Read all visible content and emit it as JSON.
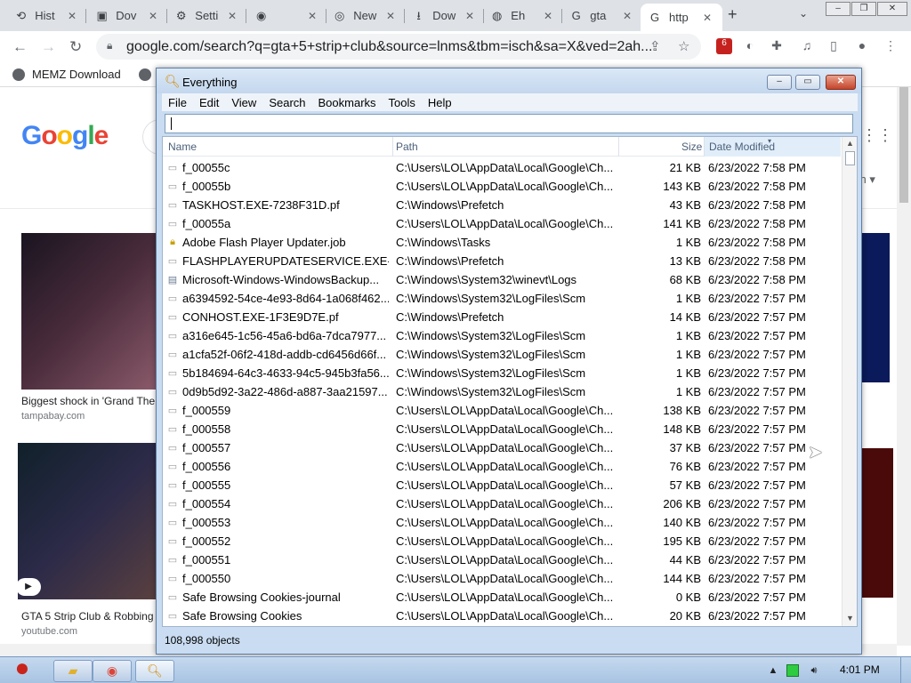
{
  "chrome": {
    "tabs": [
      {
        "label": "Hist",
        "icon": "history-icon",
        "glyph": "⟲"
      },
      {
        "label": "Dov",
        "icon": "gta-icon",
        "glyph": "▣"
      },
      {
        "label": "Setti",
        "icon": "gear-icon",
        "glyph": "⚙"
      },
      {
        "label": "",
        "icon": "app-icon",
        "glyph": "◉"
      },
      {
        "label": "New",
        "icon": "chrome-icon",
        "glyph": "◎"
      },
      {
        "label": "Dow",
        "icon": "download-icon",
        "glyph": "⭳"
      },
      {
        "label": "Eh",
        "icon": "globe-icon",
        "glyph": "◍"
      },
      {
        "label": "gta",
        "icon": "google-icon",
        "glyph": "G"
      },
      {
        "label": "http",
        "icon": "google-icon",
        "glyph": "G"
      }
    ],
    "url": "google.com/search?q=gta+5+strip+club&source=lnms&tbm=isch&sa=X&ved=2ah...",
    "bookmark": "MEMZ Download",
    "ext_badge": "6"
  },
  "google": {
    "logo": "Google",
    "results": [
      {
        "caption": "Biggest shock in 'Grand The",
        "source": "tampabay.com"
      },
      {
        "caption": "GTA 5 Strip Club & Robbing",
        "source": "youtube.com"
      }
    ],
    "more": "ch ▾"
  },
  "everything": {
    "title": "Everything",
    "menu": [
      "File",
      "Edit",
      "View",
      "Search",
      "Bookmarks",
      "Tools",
      "Help"
    ],
    "search_value": "",
    "columns": {
      "name": "Name",
      "path": "Path",
      "size": "Size",
      "date": "Date Modified"
    },
    "rows": [
      {
        "name": "f_00055c",
        "path": "C:\\Users\\LOL\\AppData\\Local\\Google\\Ch...",
        "size": "21 KB",
        "date": "6/23/2022 7:58 PM",
        "icon": "file-icon"
      },
      {
        "name": "f_00055b",
        "path": "C:\\Users\\LOL\\AppData\\Local\\Google\\Ch...",
        "size": "143 KB",
        "date": "6/23/2022 7:58 PM",
        "icon": "file-icon"
      },
      {
        "name": "TASKHOST.EXE-7238F31D.pf",
        "path": "C:\\Windows\\Prefetch",
        "size": "43 KB",
        "date": "6/23/2022 7:58 PM",
        "icon": "file-icon"
      },
      {
        "name": "f_00055a",
        "path": "C:\\Users\\LOL\\AppData\\Local\\Google\\Ch...",
        "size": "141 KB",
        "date": "6/23/2022 7:58 PM",
        "icon": "file-icon"
      },
      {
        "name": "Adobe Flash Player Updater.job",
        "path": "C:\\Windows\\Tasks",
        "size": "1 KB",
        "date": "6/23/2022 7:58 PM",
        "icon": "job-icon"
      },
      {
        "name": "FLASHPLAYERUPDATESERVICE.EXE-EC...",
        "path": "C:\\Windows\\Prefetch",
        "size": "13 KB",
        "date": "6/23/2022 7:58 PM",
        "icon": "file-icon"
      },
      {
        "name": "Microsoft-Windows-WindowsBackup...",
        "path": "C:\\Windows\\System32\\winevt\\Logs",
        "size": "68 KB",
        "date": "6/23/2022 7:58 PM",
        "icon": "log-icon"
      },
      {
        "name": "a6394592-54ce-4e93-8d64-1a068f462...",
        "path": "C:\\Windows\\System32\\LogFiles\\Scm",
        "size": "1 KB",
        "date": "6/23/2022 7:57 PM",
        "icon": "file-icon"
      },
      {
        "name": "CONHOST.EXE-1F3E9D7E.pf",
        "path": "C:\\Windows\\Prefetch",
        "size": "14 KB",
        "date": "6/23/2022 7:57 PM",
        "icon": "file-icon"
      },
      {
        "name": "a316e645-1c56-45a6-bd6a-7dca7977...",
        "path": "C:\\Windows\\System32\\LogFiles\\Scm",
        "size": "1 KB",
        "date": "6/23/2022 7:57 PM",
        "icon": "file-icon"
      },
      {
        "name": "a1cfa52f-06f2-418d-addb-cd6456d66f...",
        "path": "C:\\Windows\\System32\\LogFiles\\Scm",
        "size": "1 KB",
        "date": "6/23/2022 7:57 PM",
        "icon": "file-icon"
      },
      {
        "name": "5b184694-64c3-4633-94c5-945b3fa56...",
        "path": "C:\\Windows\\System32\\LogFiles\\Scm",
        "size": "1 KB",
        "date": "6/23/2022 7:57 PM",
        "icon": "file-icon"
      },
      {
        "name": "0d9b5d92-3a22-486d-a887-3aa21597...",
        "path": "C:\\Windows\\System32\\LogFiles\\Scm",
        "size": "1 KB",
        "date": "6/23/2022 7:57 PM",
        "icon": "file-icon"
      },
      {
        "name": "f_000559",
        "path": "C:\\Users\\LOL\\AppData\\Local\\Google\\Ch...",
        "size": "138 KB",
        "date": "6/23/2022 7:57 PM",
        "icon": "file-icon"
      },
      {
        "name": "f_000558",
        "path": "C:\\Users\\LOL\\AppData\\Local\\Google\\Ch...",
        "size": "148 KB",
        "date": "6/23/2022 7:57 PM",
        "icon": "file-icon"
      },
      {
        "name": "f_000557",
        "path": "C:\\Users\\LOL\\AppData\\Local\\Google\\Ch...",
        "size": "37 KB",
        "date": "6/23/2022 7:57 PM",
        "icon": "file-icon"
      },
      {
        "name": "f_000556",
        "path": "C:\\Users\\LOL\\AppData\\Local\\Google\\Ch...",
        "size": "76 KB",
        "date": "6/23/2022 7:57 PM",
        "icon": "file-icon"
      },
      {
        "name": "f_000555",
        "path": "C:\\Users\\LOL\\AppData\\Local\\Google\\Ch...",
        "size": "57 KB",
        "date": "6/23/2022 7:57 PM",
        "icon": "file-icon"
      },
      {
        "name": "f_000554",
        "path": "C:\\Users\\LOL\\AppData\\Local\\Google\\Ch...",
        "size": "206 KB",
        "date": "6/23/2022 7:57 PM",
        "icon": "file-icon"
      },
      {
        "name": "f_000553",
        "path": "C:\\Users\\LOL\\AppData\\Local\\Google\\Ch...",
        "size": "140 KB",
        "date": "6/23/2022 7:57 PM",
        "icon": "file-icon"
      },
      {
        "name": "f_000552",
        "path": "C:\\Users\\LOL\\AppData\\Local\\Google\\Ch...",
        "size": "195 KB",
        "date": "6/23/2022 7:57 PM",
        "icon": "file-icon"
      },
      {
        "name": "f_000551",
        "path": "C:\\Users\\LOL\\AppData\\Local\\Google\\Ch...",
        "size": "44 KB",
        "date": "6/23/2022 7:57 PM",
        "icon": "file-icon"
      },
      {
        "name": "f_000550",
        "path": "C:\\Users\\LOL\\AppData\\Local\\Google\\Ch...",
        "size": "144 KB",
        "date": "6/23/2022 7:57 PM",
        "icon": "file-icon"
      },
      {
        "name": "Safe Browsing Cookies-journal",
        "path": "C:\\Users\\LOL\\AppData\\Local\\Google\\Ch...",
        "size": "0 KB",
        "date": "6/23/2022 7:57 PM",
        "icon": "file-icon"
      },
      {
        "name": "Safe Browsing Cookies",
        "path": "C:\\Users\\LOL\\AppData\\Local\\Google\\Ch...",
        "size": "20 KB",
        "date": "6/23/2022 7:57 PM",
        "icon": "file-icon"
      }
    ],
    "status": "108,998 objects"
  },
  "taskbar": {
    "clock": "4:01 PM"
  }
}
